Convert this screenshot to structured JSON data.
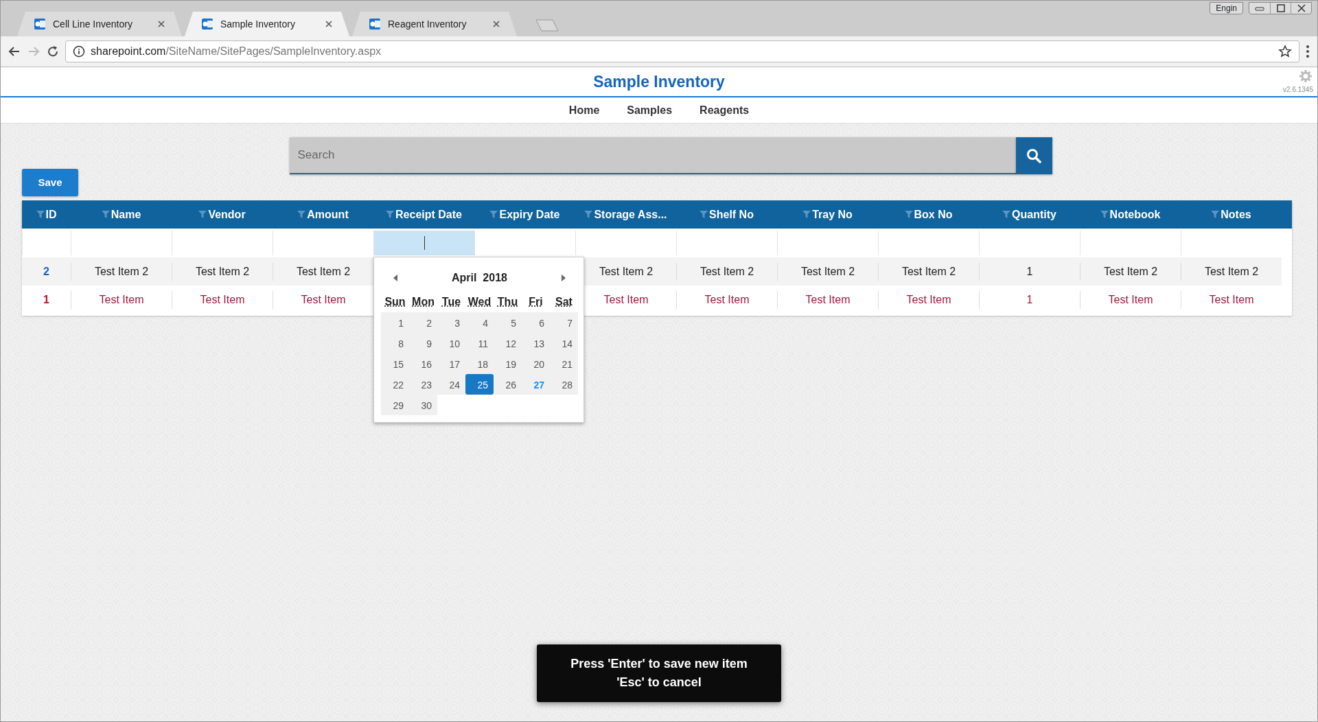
{
  "browser": {
    "tabs": [
      {
        "title": "Cell Line Inventory",
        "selected": false
      },
      {
        "title": "Sample Inventory",
        "selected": true
      },
      {
        "title": "Reagent Inventory",
        "selected": false
      }
    ],
    "user": "Engin",
    "url_host": "sharepoint.com",
    "url_path": "/SiteName/SitePages/SampleInventory.aspx"
  },
  "page": {
    "title": "Sample Inventory",
    "version": "v2.6.1345",
    "nav": [
      {
        "label": "Home"
      },
      {
        "label": "Samples"
      },
      {
        "label": "Reagents"
      }
    ]
  },
  "search": {
    "placeholder": "Search"
  },
  "save_button": "Save",
  "table": {
    "columns": [
      "ID",
      "Name",
      "Vendor",
      "Amount",
      "Receipt Date",
      "Expiry Date",
      "Storage Ass...",
      "Shelf No",
      "Tray No",
      "Box No",
      "Quantity",
      "Notebook",
      "Notes"
    ],
    "new_row": [
      {
        "selected": false
      },
      {
        "selected": false
      },
      {
        "selected": false
      },
      {
        "selected": false
      },
      {
        "selected": true
      },
      {
        "selected": false
      },
      {
        "selected": false
      },
      {
        "selected": false
      },
      {
        "selected": false
      },
      {
        "selected": false
      },
      {
        "selected": false
      },
      {
        "selected": false
      },
      {
        "selected": false
      }
    ],
    "rows": [
      {
        "kind": "saved",
        "cells": [
          "2",
          "Test Item 2",
          "Test Item 2",
          "Test Item 2",
          "",
          "",
          "Test Item 2",
          "Test Item 2",
          "Test Item 2",
          "Test Item 2",
          "1",
          "Test Item 2",
          "Test Item 2"
        ]
      },
      {
        "kind": "unsaved",
        "cells": [
          "1",
          "Test Item",
          "Test Item",
          "Test Item",
          "",
          "",
          "Test Item",
          "Test Item",
          "Test Item",
          "Test Item",
          "1",
          "Test Item",
          "Test Item"
        ]
      }
    ]
  },
  "datepicker": {
    "month": "April",
    "year": "2018",
    "weekdays": [
      "Sun",
      "Mon",
      "Tue",
      "Wed",
      "Thu",
      "Fri",
      "Sat"
    ],
    "days": [
      {
        "label": "1",
        "selected": false,
        "today": false
      },
      {
        "label": "2",
        "selected": false,
        "today": false
      },
      {
        "label": "3",
        "selected": false,
        "today": false
      },
      {
        "label": "4",
        "selected": false,
        "today": false
      },
      {
        "label": "5",
        "selected": false,
        "today": false
      },
      {
        "label": "6",
        "selected": false,
        "today": false
      },
      {
        "label": "7",
        "selected": false,
        "today": false
      },
      {
        "label": "8",
        "selected": false,
        "today": false
      },
      {
        "label": "9",
        "selected": false,
        "today": false
      },
      {
        "label": "10",
        "selected": false,
        "today": false
      },
      {
        "label": "11",
        "selected": false,
        "today": false
      },
      {
        "label": "12",
        "selected": false,
        "today": false
      },
      {
        "label": "13",
        "selected": false,
        "today": false
      },
      {
        "label": "14",
        "selected": false,
        "today": false
      },
      {
        "label": "15",
        "selected": false,
        "today": false
      },
      {
        "label": "16",
        "selected": false,
        "today": false
      },
      {
        "label": "17",
        "selected": false,
        "today": false
      },
      {
        "label": "18",
        "selected": false,
        "today": false
      },
      {
        "label": "19",
        "selected": false,
        "today": false
      },
      {
        "label": "20",
        "selected": false,
        "today": false
      },
      {
        "label": "21",
        "selected": false,
        "today": false
      },
      {
        "label": "22",
        "selected": false,
        "today": false
      },
      {
        "label": "23",
        "selected": false,
        "today": false
      },
      {
        "label": "24",
        "selected": false,
        "today": false
      },
      {
        "label": "25",
        "selected": true,
        "today": false
      },
      {
        "label": "26",
        "selected": false,
        "today": false
      },
      {
        "label": "27",
        "selected": false,
        "today": true
      },
      {
        "label": "28",
        "selected": false,
        "today": false
      },
      {
        "label": "29",
        "selected": false,
        "today": false
      },
      {
        "label": "30",
        "selected": false,
        "today": false
      }
    ]
  },
  "toast": [
    "Press 'Enter' to save new item",
    "'Esc' to cancel"
  ]
}
